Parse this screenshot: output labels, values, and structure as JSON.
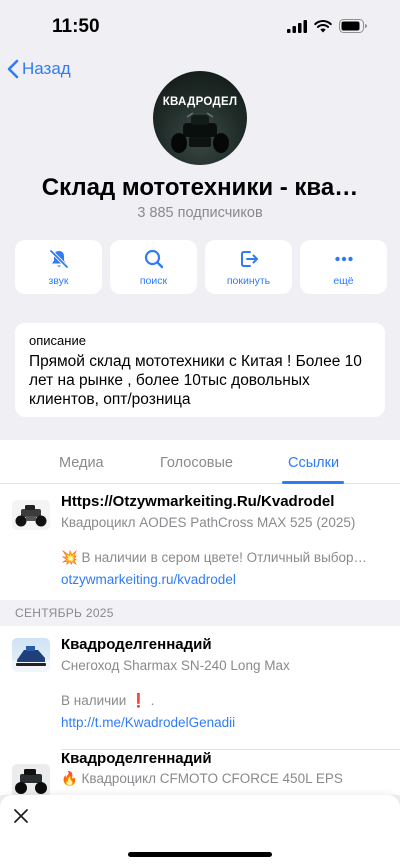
{
  "status": {
    "time": "11:50"
  },
  "nav": {
    "back_label": "Назад"
  },
  "channel": {
    "avatar_text": "КВАДРОДЕЛ",
    "title": "Склад мототехники - ква…",
    "subscribers": "3 885 подписчиков"
  },
  "actions": [
    {
      "label": "звук",
      "icon": "bell-mute-icon"
    },
    {
      "label": "поиск",
      "icon": "search-icon"
    },
    {
      "label": "покинуть",
      "icon": "leave-icon"
    },
    {
      "label": "ещё",
      "icon": "more-icon"
    }
  ],
  "description": {
    "label": "описание",
    "text": "Прямой склад мототехники с Китая ! Более 10 лет на рынке , более 10тыс довольных клиентов, опт/розница"
  },
  "tabs": [
    {
      "label": "Медиа"
    },
    {
      "label": "Голосовые"
    },
    {
      "label": "Ссылки",
      "active": true
    }
  ],
  "links": [
    {
      "title": "Https://Otzywmarkeiting.Ru/Kvadrodel",
      "subtitle": "Квадроцикл AODES PathCross MAX 525 (2025)",
      "preview": "💥 В наличии в сером цвете! Отличный выбор…",
      "url": "otzywmarkeiting.ru/kvadrodel"
    },
    {
      "title": "Квадроделгеннадий",
      "subtitle": "Снегоход Sharmax SN-240 Long Max",
      "preview": "В наличии ❗ .",
      "url": "http://t.me/KwadrodelGenadii"
    },
    {
      "title": "Квадроделгеннадий",
      "subtitle": "🔥 Квадроцикл CFMOTO CFORCE 450L EPS"
    }
  ],
  "section_header": "СЕНТЯБРЬ 2025",
  "colors": {
    "accent": "#2f7cf6",
    "background": "#efeff4",
    "muted": "#8a8a8e"
  }
}
